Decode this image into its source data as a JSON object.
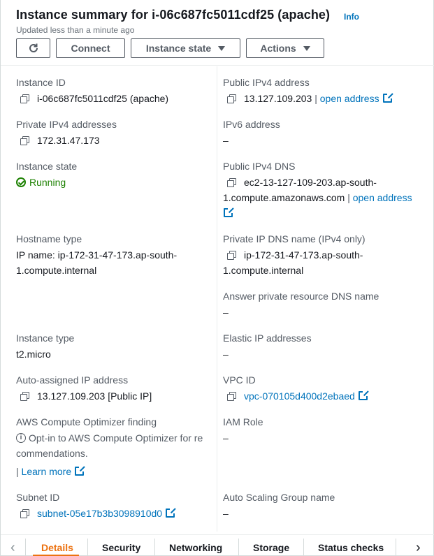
{
  "header": {
    "title": "Instance summary for i-06c687fc5011cdf25 (apache)",
    "info": "Info",
    "subtitle": "Updated less than a minute ago",
    "buttons": {
      "refresh": "⟳",
      "connect": "Connect",
      "instance_state": "Instance state",
      "actions": "Actions"
    }
  },
  "left": {
    "instance_id": {
      "label": "Instance ID",
      "value": "i-06c687fc5011cdf25 (apache)"
    },
    "private_ipv4": {
      "label": "Private IPv4 addresses",
      "value": "172.31.47.173"
    },
    "instance_state": {
      "label": "Instance state",
      "value": "Running"
    },
    "hostname_type": {
      "label": "Hostname type",
      "line1": "IP name: ip-172-31-47-173.ap-south-",
      "line2": "1.compute.internal"
    },
    "instance_type": {
      "label": "Instance type",
      "value": "t2.micro"
    },
    "auto_ip": {
      "label": "Auto-assigned IP address",
      "value": "13.127.109.203 [Public IP]"
    },
    "optimizer": {
      "label": "AWS Compute Optimizer finding",
      "line1": "Opt-in to AWS Compute Optimizer for re",
      "line2": "commendations.",
      "link": "Learn more"
    },
    "subnet": {
      "label": "Subnet ID",
      "value": "subnet-05e17b3b3098910d0"
    }
  },
  "right": {
    "public_ipv4": {
      "label": "Public IPv4 address",
      "value": "13.127.109.203",
      "sep": "|",
      "link": "open address"
    },
    "ipv6": {
      "label": "IPv6 address",
      "value": "–"
    },
    "public_dns": {
      "label": "Public IPv4 DNS",
      "line1": "ec2-13-127-109-203.ap-south-",
      "line2": "1.compute.amazonaws.com",
      "sep": "|",
      "link": "open address"
    },
    "private_dns": {
      "label": "Private IP DNS name (IPv4 only)",
      "line1": "ip-172-31-47-173.ap-south-",
      "line2": "1.compute.internal"
    },
    "answer_dns": {
      "label": "Answer private resource DNS name",
      "value": "–"
    },
    "elastic_ip": {
      "label": "Elastic IP addresses",
      "value": "–"
    },
    "vpc": {
      "label": "VPC ID",
      "value": "vpc-070105d400d2ebaed"
    },
    "iam": {
      "label": "IAM Role",
      "value": "–"
    },
    "asg": {
      "label": "Auto Scaling Group name",
      "value": "–"
    }
  },
  "tabs": {
    "prev": "‹",
    "next": "›",
    "items": [
      "Details",
      "Security",
      "Networking",
      "Storage",
      "Status checks"
    ],
    "active": "Details"
  },
  "colors": {
    "link": "#0073bb",
    "running": "#1d8102",
    "active_tab": "#ec7211"
  }
}
